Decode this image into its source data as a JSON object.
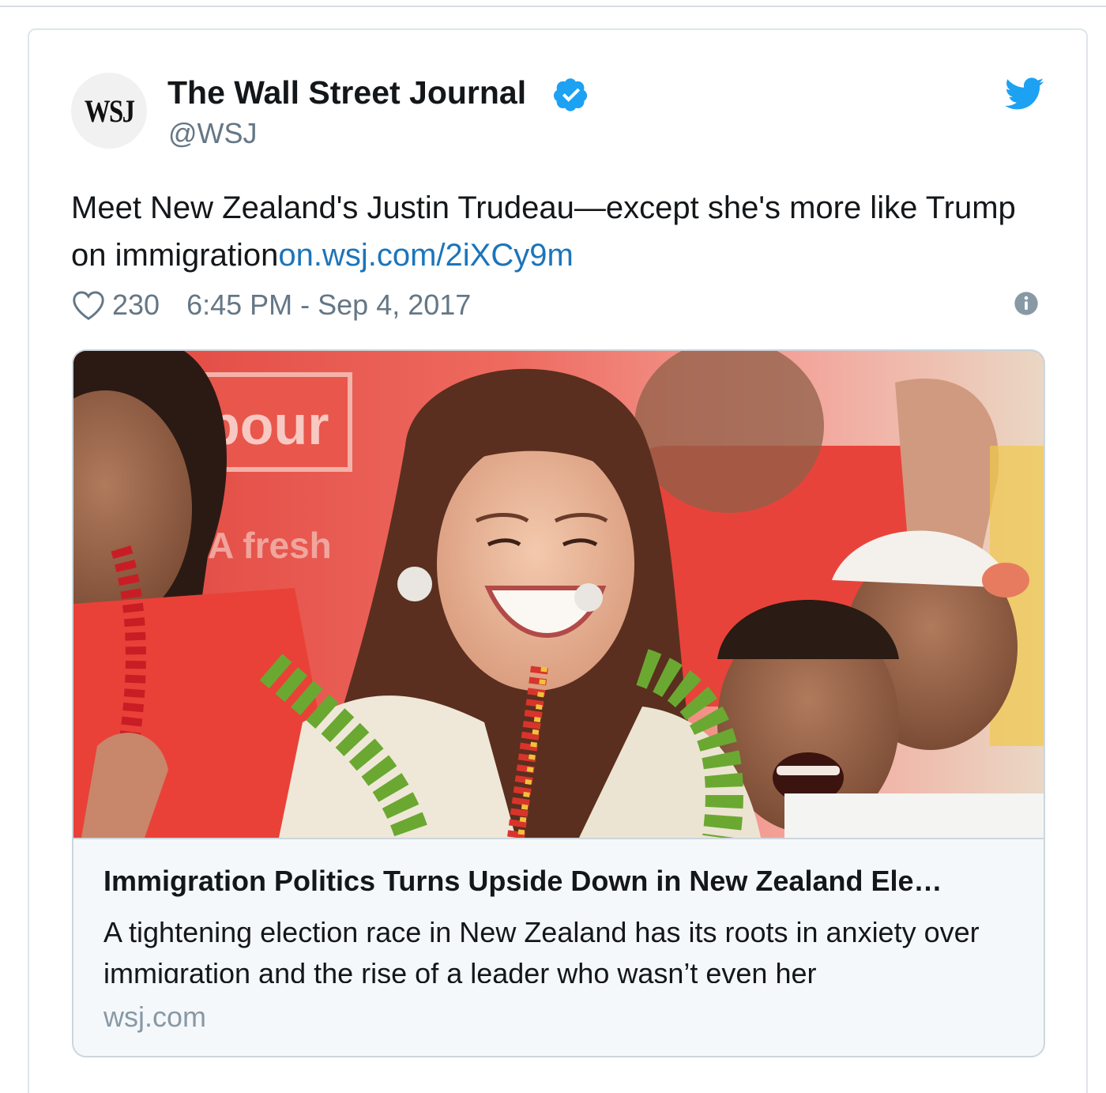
{
  "author": {
    "avatar_text": "WSJ",
    "name": "The Wall Street Journal",
    "handle": "@WSJ",
    "verified": true
  },
  "tweet": {
    "text": "Meet New Zealand's Justin Trudeau—except she's more like Trump on immigration",
    "link_text": "on.wsj.com/2iXCy9m"
  },
  "meta": {
    "like_count": "230",
    "timestamp": "6:45 PM - Sep 4, 2017"
  },
  "card": {
    "photo_sign_text": "bour",
    "photo_sign_subtext": "A fresh",
    "title": "Immigration Politics Turns Upside Down in New Zealand Ele…",
    "description": "A tightening election race in New Zealand has its roots in anxiety over immigration and the rise of a leader who wasn’t even her",
    "domain": "wsj.com"
  },
  "icons": {
    "verified": "verified-badge-icon",
    "brand": "twitter-bird-icon",
    "like": "heart-icon",
    "info": "info-icon"
  },
  "colors": {
    "link": "#1b75bb",
    "verified": "#1da1f2",
    "twitter": "#1da1f2",
    "secondary_text": "#657786"
  }
}
